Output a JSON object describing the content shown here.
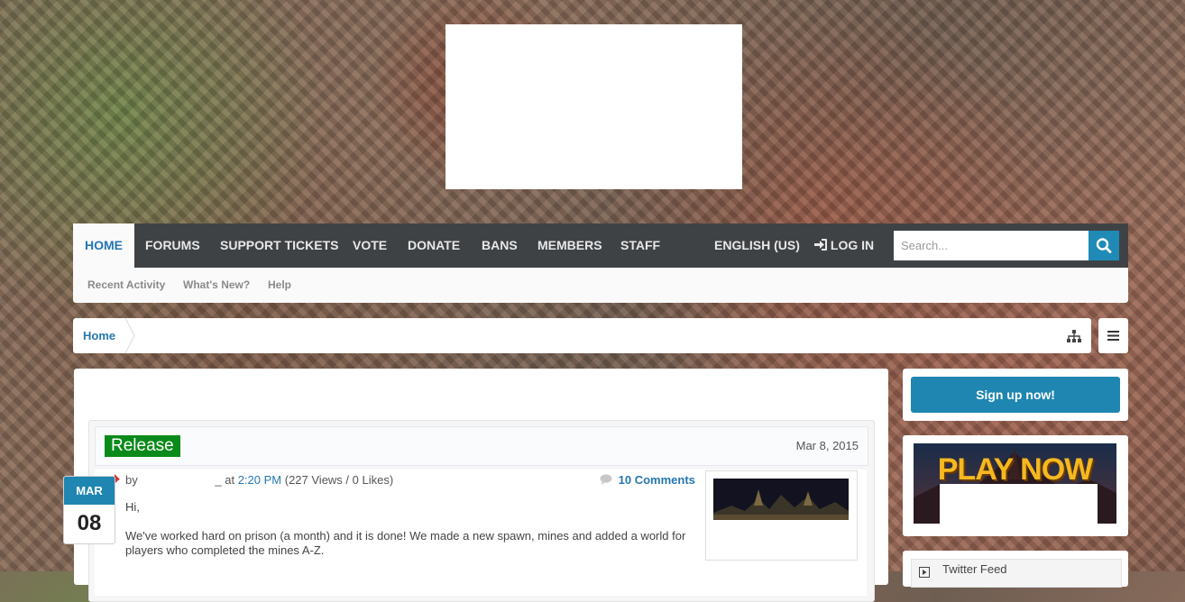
{
  "nav": {
    "items": [
      {
        "label": "HOME",
        "active": true
      },
      {
        "label": "FORUMS"
      },
      {
        "label": "SUPPORT TICKETS"
      },
      {
        "label": "VOTE"
      },
      {
        "label": "DONATE"
      },
      {
        "label": "BANS"
      },
      {
        "label": "MEMBERS"
      },
      {
        "label": "STAFF"
      }
    ],
    "language": "ENGLISH (US)",
    "login": "LOG IN",
    "search_placeholder": "Search...",
    "login_icon": "sign-in-icon",
    "search_icon": "search-icon"
  },
  "subnav": {
    "items": [
      "Recent Activity",
      "What's New?",
      "Help"
    ]
  },
  "breadcrumb": {
    "home": "Home",
    "sitemap_icon": "sitemap-icon",
    "menu_icon": "hamburger-menu-icon"
  },
  "post": {
    "tag": "Release",
    "date": "Mar 8, 2015",
    "badge_month": "MAR",
    "badge_day": "08",
    "meta_by": "by",
    "meta_author_trail": "_",
    "meta_at": "at",
    "time": "2:20 PM",
    "stats": "(227 Views / 0 Likes)",
    "comments": "10 Comments",
    "greeting": "Hi,",
    "body": "We've worked hard on prison (a month) and it is done! We made a new spawn, mines and added a world for players who completed the mines A-Z.",
    "pin_icon": "pushpin-icon",
    "comment_icon": "speech-bubble-icon"
  },
  "sidebar": {
    "signup": "Sign up now!",
    "banner_text": "PLAY NOW",
    "twitter_title": "Twitter Feed",
    "twitter_icon": "twitter-icon"
  },
  "colors": {
    "accent": "#1f86b1",
    "link": "#2577b1",
    "nav_bg": "#3f4245",
    "release_green": "#0a8a1a"
  }
}
